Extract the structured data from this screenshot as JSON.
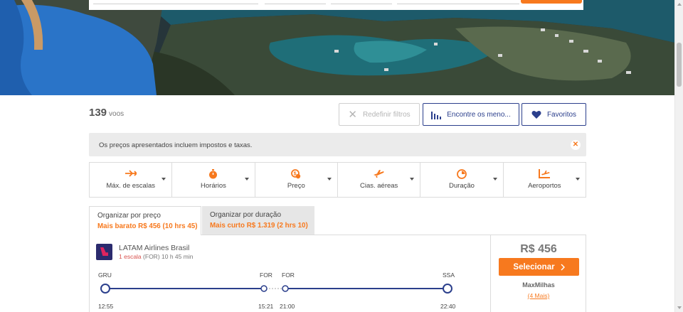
{
  "hero": {
    "image_desc": "coastal-village-aerial"
  },
  "results": {
    "count": "139",
    "count_unit": "voos"
  },
  "toolbar": {
    "reset_label": "Redefinir filtros",
    "find_label": "Encontre os meno...",
    "favorites_label": "Favoritos"
  },
  "banner": {
    "text": "Os preços apresentados incluem impostos e taxas."
  },
  "filters": [
    {
      "label": "Máx. de escalas",
      "icon": "stops-icon"
    },
    {
      "label": "Horários",
      "icon": "clock-icon"
    },
    {
      "label": "Preço",
      "icon": "price-icon"
    },
    {
      "label": "Cias. aéreas",
      "icon": "plane-icon"
    },
    {
      "label": "Duração",
      "icon": "duration-icon"
    },
    {
      "label": "Aeroportos",
      "icon": "airport-icon"
    }
  ],
  "sort": {
    "price_title": "Organizar por preço",
    "price_sub": "Mais barato R$ 456 (10 hrs 45)",
    "duration_title": "Organizar por duração",
    "duration_sub": "Mais curto R$ 1.319 (2 hrs 10)"
  },
  "flight": {
    "airline": "LATAM Airlines Brasil",
    "stops": "1 escala",
    "via_duration": "(FOR) 10 h 45 min",
    "segments": [
      {
        "from": "GRU",
        "to": "FOR",
        "dep": "12:55",
        "arr": "15:21"
      },
      {
        "from": "FOR",
        "to": "SSA",
        "dep": "21:00",
        "arr": "22:40"
      }
    ],
    "price": "R$ 456",
    "select_label": "Selecionar",
    "seller": "MaxMilhas",
    "more_label": "(4 Mais)"
  },
  "colors": {
    "accent": "#f7791e",
    "primary": "#2b3f8c",
    "stop_red": "#d9534f"
  }
}
